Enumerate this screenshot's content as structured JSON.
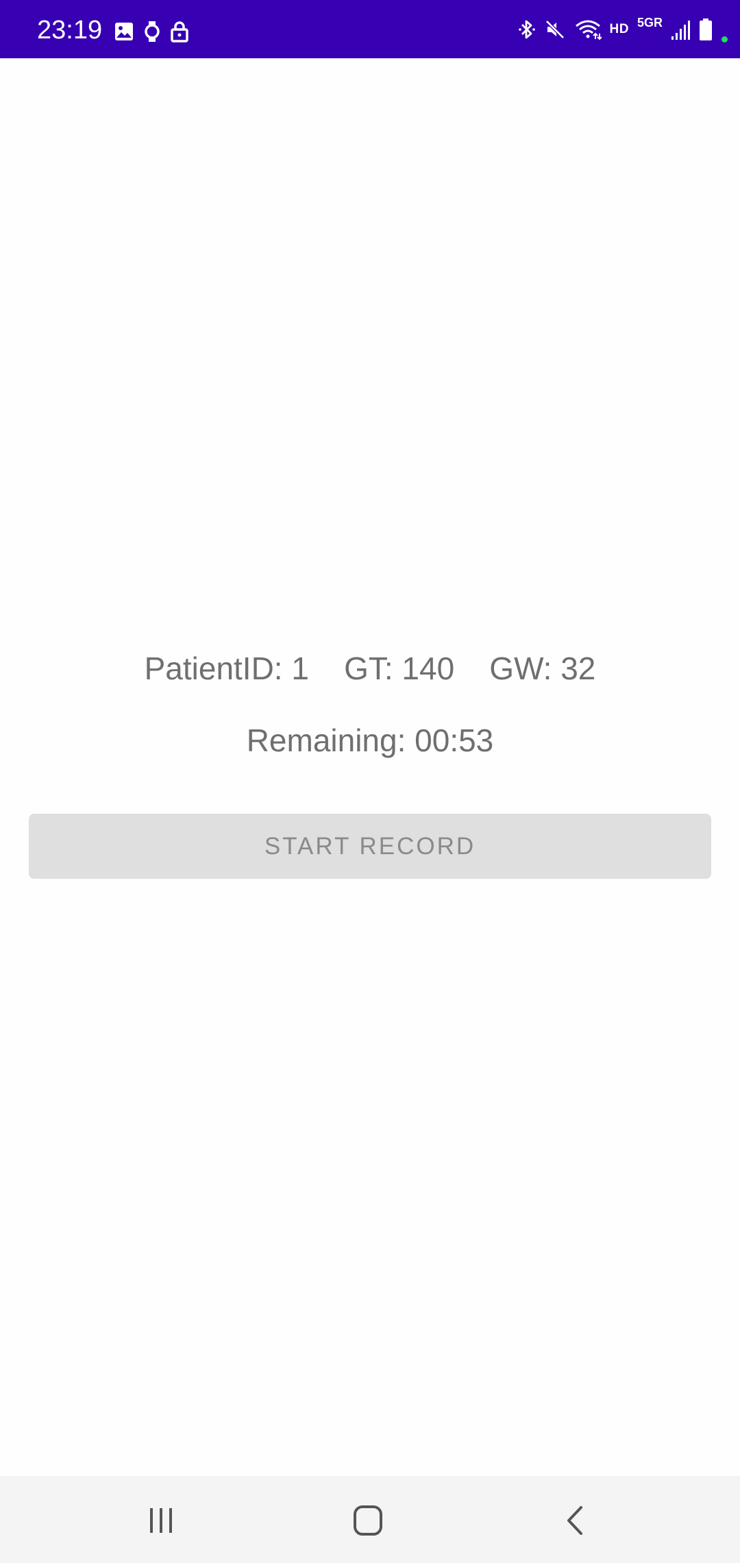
{
  "status_bar": {
    "time": "23:19",
    "background_color": "#3700b3",
    "left_icons": [
      "gallery-icon",
      "watch-icon",
      "lock-icon"
    ],
    "hd_label": "HD",
    "network_label": "5GR",
    "right_icons": [
      "bluetooth-icon",
      "mute-icon",
      "wifi-icon",
      "signal-icon",
      "battery-icon"
    ]
  },
  "main": {
    "patient_line": {
      "patient_id": "PatientID: 1",
      "gt": "GT: 140",
      "gw": "GW: 32"
    },
    "remaining": "Remaining: 00:53",
    "start_button_label": "START RECORD"
  },
  "nav_bar": {
    "items": [
      "recents-icon",
      "home-icon",
      "back-icon"
    ]
  }
}
